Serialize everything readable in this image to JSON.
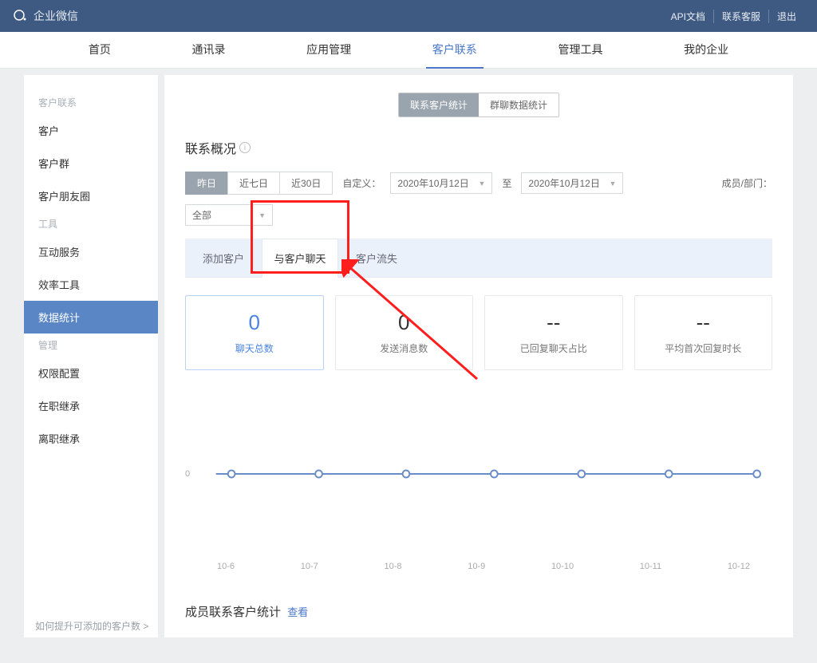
{
  "header": {
    "brand": "企业微信",
    "links": [
      "API文档",
      "联系客服",
      "退出"
    ]
  },
  "nav": {
    "items": [
      "首页",
      "通讯录",
      "应用管理",
      "客户联系",
      "管理工具",
      "我的企业"
    ],
    "active": "客户联系"
  },
  "sidebar": {
    "groups": [
      {
        "label": "客户联系",
        "items": [
          "客户",
          "客户群",
          "客户朋友圈"
        ]
      },
      {
        "label": "工具",
        "items": [
          "互动服务",
          "效率工具",
          "数据统计"
        ]
      },
      {
        "label": "管理",
        "items": [
          "权限配置",
          "在职继承",
          "离职继承"
        ]
      }
    ],
    "active": "数据统计",
    "tip": "如何提升可添加的客户数 >"
  },
  "segment": {
    "options": [
      "联系客户统计",
      "群聊数据统计"
    ],
    "active": "联系客户统计"
  },
  "section": {
    "title": "联系概况"
  },
  "timeRange": {
    "options": [
      "昨日",
      "近七日",
      "近30日"
    ],
    "active": "昨日",
    "customLabel": "自定义：",
    "from": "2020年10月12日",
    "toLabel": "至",
    "to": "2020年10月12日",
    "deptLabel": "成员/部门：",
    "deptValue": "全部"
  },
  "tabs": {
    "items": [
      "添加客户",
      "与客户聊天",
      "客户流失"
    ],
    "active": "与客户聊天"
  },
  "cards": [
    {
      "value": "0",
      "label": "聊天总数",
      "selected": true
    },
    {
      "value": "0",
      "label": "发送消息数",
      "selected": false
    },
    {
      "value": "--",
      "label": "已回复聊天占比",
      "selected": false
    },
    {
      "value": "--",
      "label": "平均首次回复时长",
      "selected": false
    }
  ],
  "chart_data": {
    "type": "line",
    "categories": [
      "10-6",
      "10-7",
      "10-8",
      "10-9",
      "10-10",
      "10-11",
      "10-12"
    ],
    "values": [
      0,
      0,
      0,
      0,
      0,
      0,
      0
    ],
    "ylabel": "0",
    "ylim": [
      0,
      1
    ]
  },
  "section2": {
    "title": "成员联系客户统计",
    "link": "查看"
  }
}
